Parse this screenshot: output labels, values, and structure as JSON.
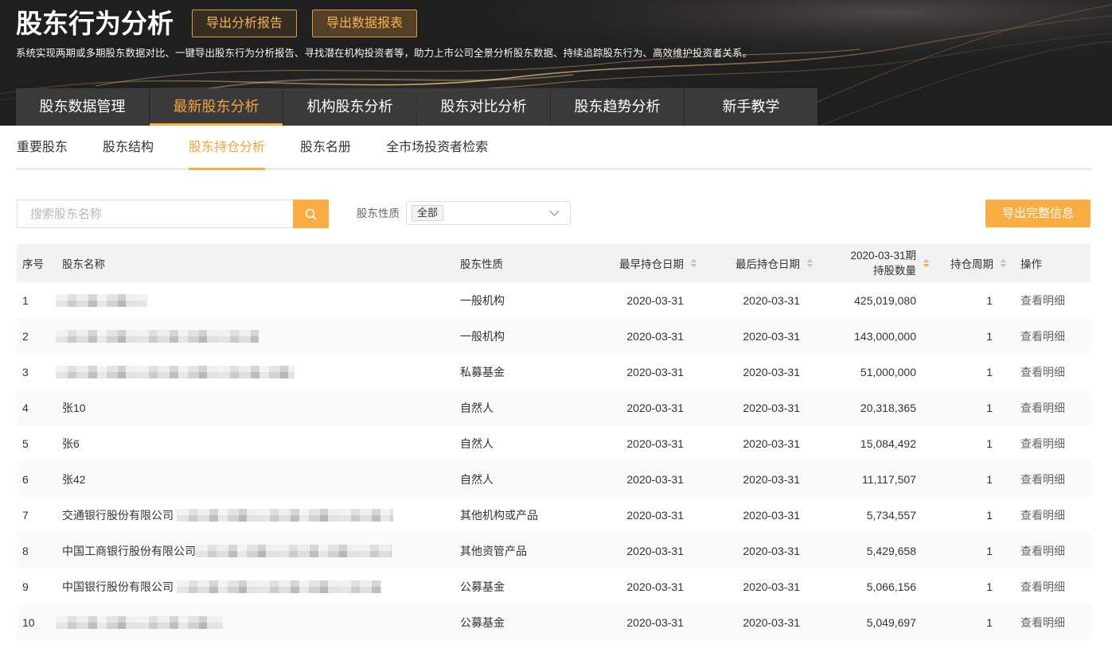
{
  "colors": {
    "accent": "#fbad42",
    "active_text": "#f5a33a",
    "hero_bg": "#1f1f1f"
  },
  "header": {
    "title": "股东行为分析",
    "buttons": [
      {
        "label": "导出分析报告"
      },
      {
        "label": "导出数据报表"
      }
    ],
    "subtitle": "系统实现两期或多期股东数据对比、一键导出股东行为分析报告、寻找潜在机构投资者等，助力上市公司全景分析股东数据、持续追踪股东行为、高效维护投资者关系。"
  },
  "main_tabs": [
    {
      "label": "股东数据管理"
    },
    {
      "label": "最新股东分析",
      "active": true
    },
    {
      "label": "机构股东分析"
    },
    {
      "label": "股东对比分析"
    },
    {
      "label": "股东趋势分析"
    },
    {
      "label": "新手教学"
    }
  ],
  "sub_tabs": [
    {
      "label": "重要股东"
    },
    {
      "label": "股东结构"
    },
    {
      "label": "股东持仓分析",
      "active": true
    },
    {
      "label": "股东名册"
    },
    {
      "label": "全市场投资者检索"
    }
  ],
  "filters": {
    "search": {
      "placeholder": "搜索股东名称",
      "icon": "search-icon"
    },
    "holder_nature": {
      "label": "股东性质",
      "selected": "全部",
      "icon": "chevron-down-icon"
    },
    "export_label": "导出完整信息"
  },
  "table": {
    "columns": [
      {
        "label": "序号"
      },
      {
        "label": "股东名称"
      },
      {
        "label": "股东性质"
      },
      {
        "label": "最早持仓日期",
        "sortable": true
      },
      {
        "label": "最后持仓日期",
        "sortable": true
      },
      {
        "label": "2020-03-31期",
        "label_line2": "持股数量",
        "sortable": true,
        "sorted_desc": true
      },
      {
        "label": "持仓周期",
        "sortable": true
      },
      {
        "label": "操作"
      }
    ],
    "rows": [
      {
        "no": "1",
        "name": "",
        "nature": "一般机构",
        "first_date": "2020-03-31",
        "last_date": "2020-03-31",
        "shares": "425,019,080",
        "period": "1",
        "action": "查看明细"
      },
      {
        "no": "2",
        "name": "",
        "nature": "一般机构",
        "first_date": "2020-03-31",
        "last_date": "2020-03-31",
        "shares": "143,000,000",
        "period": "1",
        "action": "查看明细"
      },
      {
        "no": "3",
        "name": "",
        "nature": "私募基金",
        "first_date": "2020-03-31",
        "last_date": "2020-03-31",
        "shares": "51,000,000",
        "period": "1",
        "action": "查看明细"
      },
      {
        "no": "4",
        "name": "张10",
        "nature": "自然人",
        "first_date": "2020-03-31",
        "last_date": "2020-03-31",
        "shares": "20,318,365",
        "period": "1",
        "action": "查看明细"
      },
      {
        "no": "5",
        "name": "张6",
        "nature": "自然人",
        "first_date": "2020-03-31",
        "last_date": "2020-03-31",
        "shares": "15,084,492",
        "period": "1",
        "action": "查看明细"
      },
      {
        "no": "6",
        "name": "张42",
        "nature": "自然人",
        "first_date": "2020-03-31",
        "last_date": "2020-03-31",
        "shares": "11,117,507",
        "period": "1",
        "action": "查看明细"
      },
      {
        "no": "7",
        "name": "交通银行股份有限公司",
        "nature": "其他机构或产品",
        "first_date": "2020-03-31",
        "last_date": "2020-03-31",
        "shares": "5,734,557",
        "period": "1",
        "action": "查看明细"
      },
      {
        "no": "8",
        "name": "中国工商银行股份有限公司",
        "nature": "其他资管产品",
        "first_date": "2020-03-31",
        "last_date": "2020-03-31",
        "shares": "5,429,658",
        "period": "1",
        "action": "查看明细"
      },
      {
        "no": "9",
        "name": "中国银行股份有限公司",
        "nature": "公募基金",
        "first_date": "2020-03-31",
        "last_date": "2020-03-31",
        "shares": "5,066,156",
        "period": "1",
        "action": "查看明细"
      },
      {
        "no": "10",
        "name": "",
        "nature": "公募基金",
        "first_date": "2020-03-31",
        "last_date": "2020-03-31",
        "shares": "5,049,697",
        "period": "1",
        "action": "查看明细"
      }
    ]
  }
}
